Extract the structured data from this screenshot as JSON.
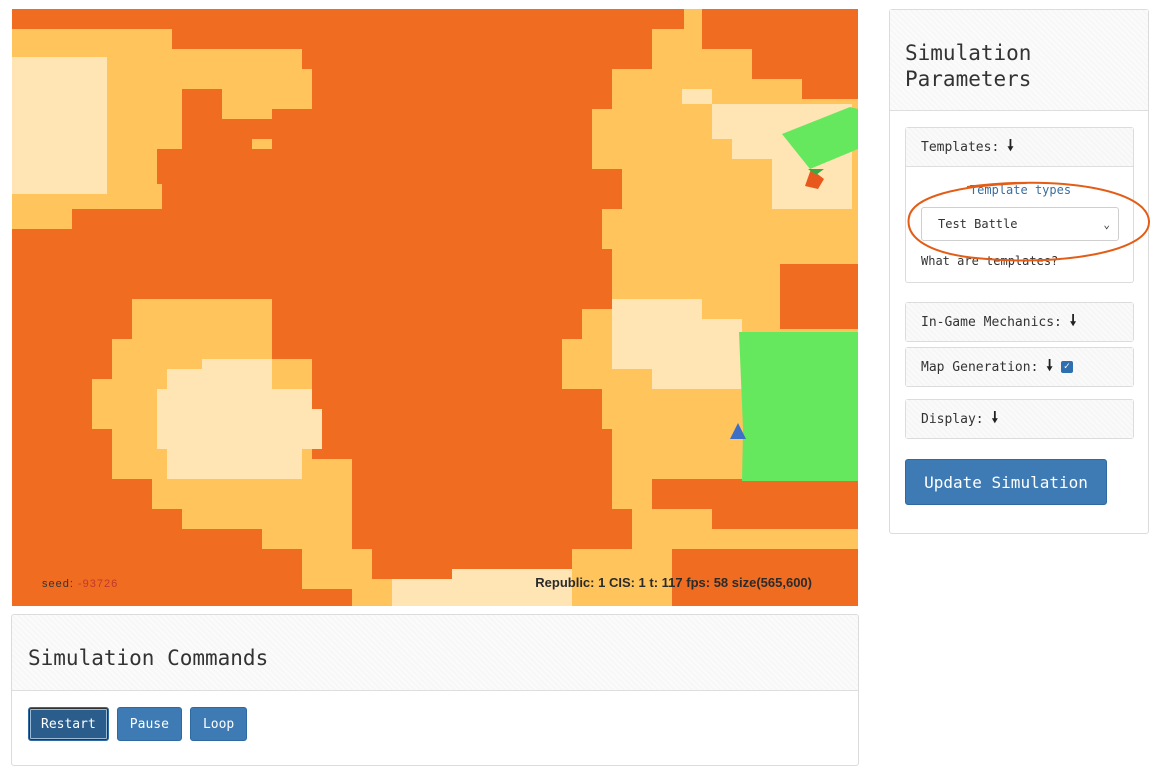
{
  "map": {
    "seed_label": "seed:",
    "seed_value": "-93726",
    "stats": "Republic: 1 CIS: 1 t: 117 fps: 58 size(565,600)",
    "colors": {
      "dark_orange": "#f06c20",
      "mid_orange": "#ffc55c",
      "light_cream": "#ffe4b4",
      "green_zone": "#66e85e",
      "republic_unit": "#3d6fc7",
      "cis_unit": "#e8581c"
    }
  },
  "commands": {
    "title": "Simulation Commands",
    "buttons": [
      "Restart",
      "Pause",
      "Loop"
    ]
  },
  "params": {
    "title": "Simulation\nParameters",
    "templates": {
      "header": "Templates:",
      "label": "Template types",
      "selected": "Test Battle",
      "help": "What are templates?"
    },
    "in_game": {
      "header": "In-Game Mechanics:"
    },
    "map_gen": {
      "header": "Map Generation:",
      "checked": true
    },
    "display": {
      "header": "Display:"
    },
    "update_button": "Update Simulation"
  },
  "annotation_color": "#e35d17"
}
